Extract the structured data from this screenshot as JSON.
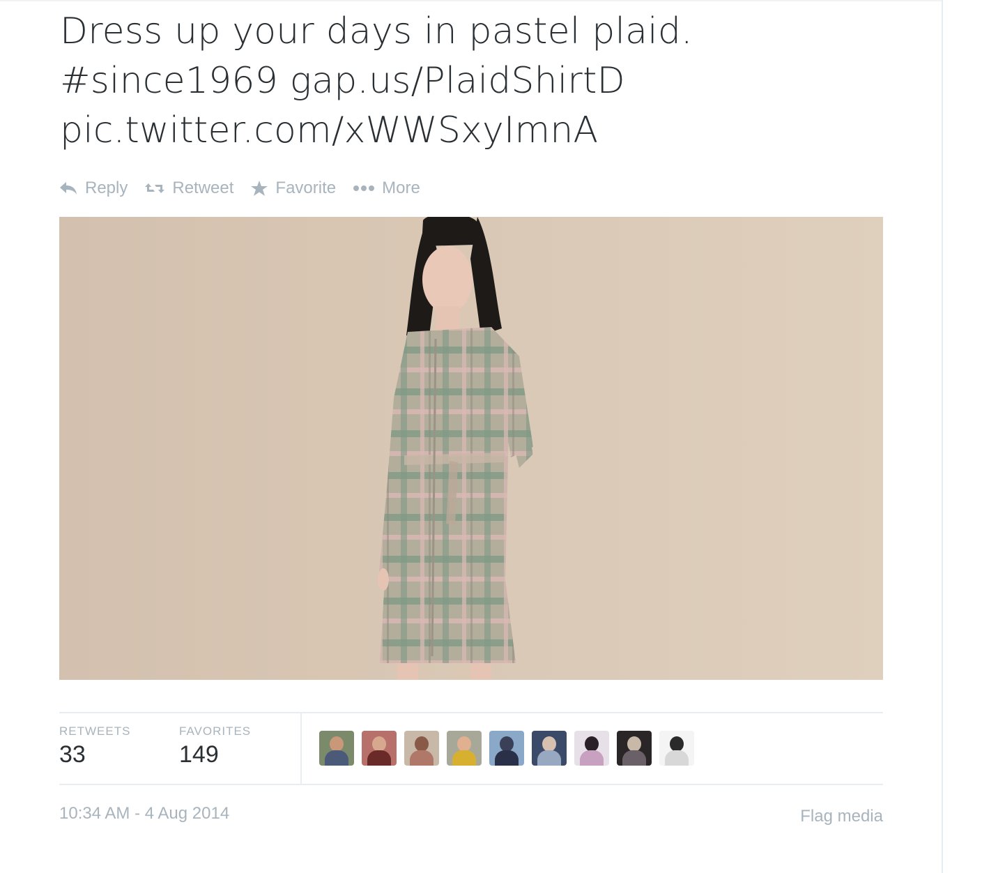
{
  "tweet": {
    "line1": "Dress up your days in pastel plaid.",
    "hashtag": "#since1969",
    "link": "gap.us/PlaidShirtD",
    "pic_link": "pic.twitter.com/xWWSxyImnA"
  },
  "actions": {
    "reply": "Reply",
    "retweet": "Retweet",
    "favorite": "Favorite",
    "more": "More"
  },
  "stats": {
    "retweets_label": "RETWEETS",
    "retweets_count": "33",
    "favorites_label": "FAVORITES",
    "favorites_count": "149"
  },
  "footer": {
    "timestamp": "10:34 AM - 4 Aug 2014",
    "flag": "Flag media"
  },
  "colors": {
    "text": "#292f33",
    "muted": "#a8b4bd",
    "photo_background": "#d8c6b4",
    "plaid_green": "#7d9a86",
    "plaid_pink": "#d9b9b5"
  }
}
